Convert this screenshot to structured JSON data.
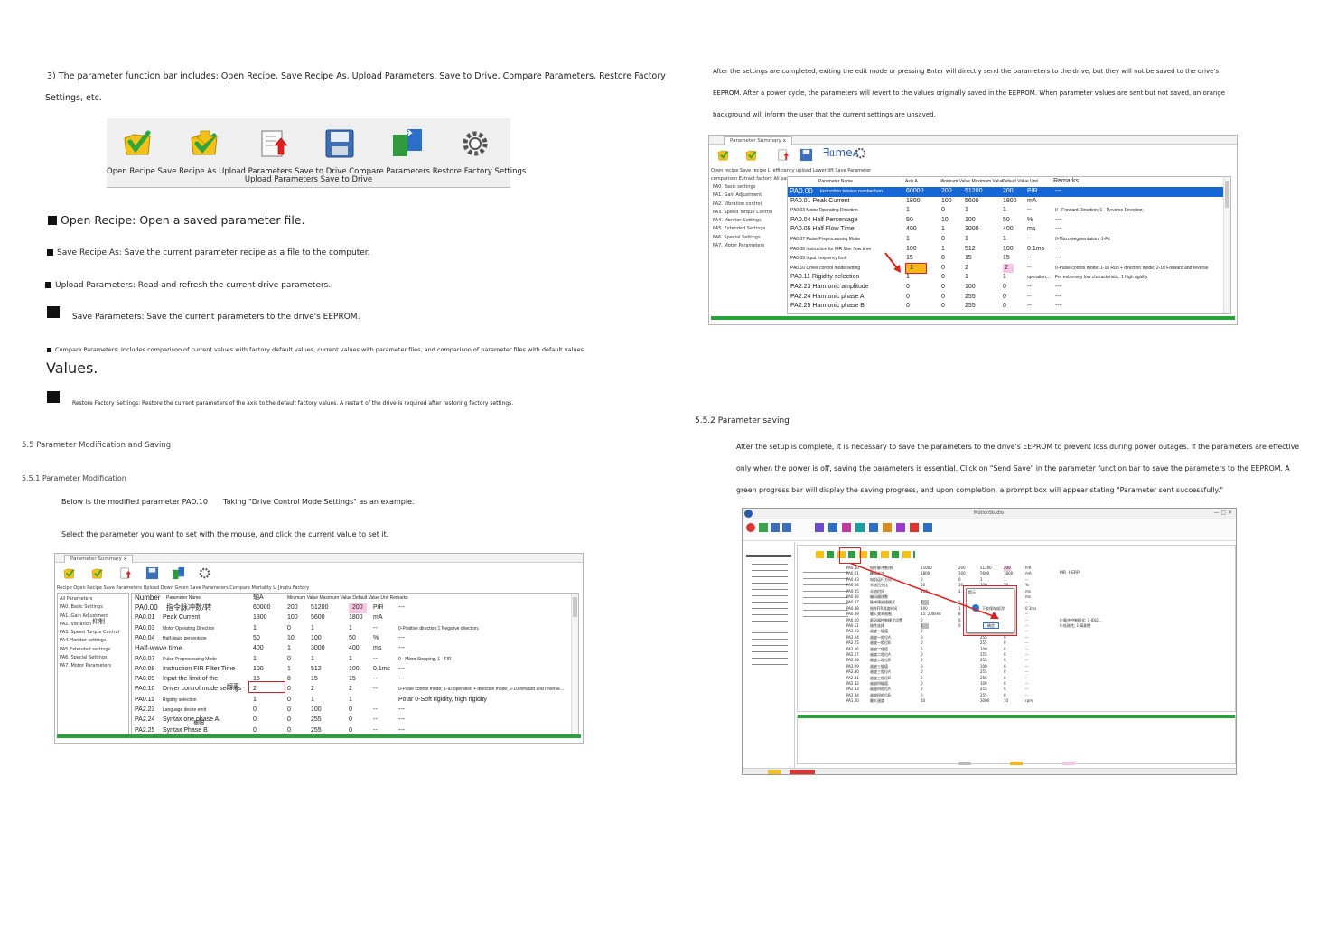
{
  "left": {
    "intro_line1": "3) The parameter function bar includes: Open Recipe, Save Recipe As, Upload Parameters, Save to Drive, Compare Parameters, Restore Factory",
    "intro_line2": "Settings, etc.",
    "toolbar_caption_line1": "Open Recipe Save Recipe As Upload Parameters Save to Drive Compare Parameters Restore Factory Settings",
    "toolbar_caption_line2": "Upload Parameters Save to Drive",
    "bullet_open": "Open Recipe: Open a saved parameter file.",
    "bullet_save_as": "Save Recipe As: Save the current parameter recipe as a file to the computer.",
    "bullet_upload": "Upload Parameters: Read and refresh the current drive parameters.",
    "bullet_save": "Save Parameters: Save the current parameters to the drive's EEPROM.",
    "bullet_compare": "Compare Parameters: Includes comparison of current values with factory default values, current values with parameter files, and comparison of parameter files with default values.",
    "values_heading": "Values.",
    "bullet_restore": "Restore Factory Settings: Restore the current parameters of the axis to the default factory values. A restart of the drive is required after restoring factory settings.",
    "section_55": "5.5 Parameter Modification and Saving",
    "section_551": "5.5.1 Parameter Modification",
    "modified_line_a": "Below is the modified parameter PAO.10",
    "modified_line_b": "Taking \"Drive Control Mode Settings\" as an example.",
    "select_line": "Select the parameter you want to set with the mouse, and click the current value to set it."
  },
  "left_window": {
    "tab": "Parameter Summary x",
    "menu": "Recipe Open Recipe Save Parameters Upload Down Green Save Parameters Compare Mortality Li Jingtu Factory",
    "tree": [
      "All Parameters",
      "PA0. Basic Settings",
      "PA1. Gain Adjustment",
      "PA2. Vibration",
      "PA3. Speed Torque Control",
      "PA4.Monitor settings",
      "PA5.Extended settings",
      "PA6. Special Settings",
      "PA7. Motor Parameters"
    ],
    "tree_overlay": "抑制",
    "header": {
      "number": "Number",
      "name": "Parameter Name",
      "axis": "轴A",
      "rest": "Minimum Value Maximum Value Default Value Unit Remarks"
    },
    "rows": [
      {
        "num": "PA0.00",
        "name": "指令脉冲数/转",
        "a": "60000",
        "min": "200",
        "max": "51200",
        "def": "200",
        "unit": "P/R",
        "rem": "---"
      },
      {
        "num": "PA0.01",
        "name": "Peak Current",
        "a": "1800",
        "min": "100",
        "max": "5600",
        "def": "1800",
        "unit": "mA",
        "rem": ""
      },
      {
        "num": "PA0.03",
        "name": "Motor Operating Direction",
        "a": "1",
        "min": "0",
        "max": "1",
        "def": "1",
        "unit": "--",
        "rem": "0-Positive direction;1 Negative direction;"
      },
      {
        "num": "PA0.04",
        "name": "Half-liquid percentage",
        "a": "50",
        "min": "10",
        "max": "100",
        "def": "50",
        "unit": "%",
        "rem": "---"
      },
      {
        "num": "",
        "name": "Half-wave time",
        "a": "400",
        "min": "1",
        "max": "3000",
        "def": "400",
        "unit": "ms",
        "rem": "---"
      },
      {
        "num": "PA0.07",
        "name": "Pulse Preprocessing Mode",
        "a": "1",
        "min": "0",
        "max": "1",
        "def": "1",
        "unit": "--",
        "rem": "0 - Micro Stepping, 1 - FIR"
      },
      {
        "num": "PA0.08",
        "name": "Instruction FIR Filter Time",
        "a": "100",
        "min": "1",
        "max": "512",
        "def": "100",
        "unit": "0.1ms",
        "rem": "---"
      },
      {
        "num": "PA0.09",
        "name": "Input the limit of the",
        "a": "15",
        "min": "8",
        "max": "15",
        "def": "15",
        "unit": "--",
        "rem": "---"
      },
      {
        "num": "PA0.10",
        "name": "Driver control mode settings",
        "a": "2",
        "min": "0",
        "max": "2",
        "def": "2",
        "unit": "--",
        "rem": "0-Pulse control mode; 1-ID operation + direction mode; 2-10 forward and reverse..."
      },
      {
        "num": "PA0.11",
        "name": "Rigidity selection",
        "a": "1",
        "min": "0",
        "max": "1",
        "def": "1",
        "unit": "",
        "rem": "Polar 0-Soft rigidity, high rigidity"
      },
      {
        "num": "PA2.23",
        "name": "Language desire emit",
        "a": "0",
        "min": "0",
        "max": "100",
        "def": "0",
        "unit": "--",
        "rem": "---"
      },
      {
        "num": "PA2.24",
        "name": "Syntax one phase A",
        "a": "0",
        "min": "0",
        "max": "255",
        "def": "0",
        "unit": "--",
        "rem": "---"
      },
      {
        "num": "PA2.25",
        "name": "Syntax Phase B",
        "a": "0",
        "min": "0",
        "max": "255",
        "def": "0",
        "unit": "--",
        "rem": "---"
      }
    ],
    "overlay_1": "频率",
    "overlay_2": "振幅"
  },
  "right": {
    "para1": "After the settings are completed, exiting the edit mode or pressing Enter will directly send the parameters to the drive, but they will not be saved to the drive's",
    "para2": "EEPROM. After a power cycle, the parameters will revert to the values originally saved in the EEPROM. When parameter values are sent but not saved, an orange",
    "para3": "background will inform the user that the current settings are unsaved.",
    "section_552": "5.5.2 Parameter saving",
    "save1": "After the setup is complete, it is necessary to save the parameters to the drive's EEPROM to prevent loss during power outages. If the parameters are effective",
    "save2": "only when the power is off, saving the parameters is essential. Click on \"Send Save\" in the parameter function bar to save the parameters to the EEPROM. A",
    "save3": "green progress bar will display the saving progress, and upon completion, a prompt box will appear stating \"Parameter sent successfully.\""
  },
  "right_window": {
    "tab": "Parameter Summary x",
    "mirrored": "ᖷᥲmeʌ",
    "menu_line1": "Open recipe Save recipe Li efficiency upload Lower lift Save Parameter",
    "menu_line2": "comparison Extract factory All parameter numbers",
    "tree": [
      "PA0. Basic settings",
      "PA1. Gain Adjustment",
      "PA2. Vibration control",
      "PA3. Speed Torque Control",
      "PA4. Monitor Settings",
      "PA5. Extended Settings",
      "PA6. Special Settings",
      "PA7. Motor Parameters"
    ],
    "header": {
      "name": "Parameter Name",
      "axis": "Axis A",
      "minmax": "Minimum Value Maximum Value",
      "default": "Default Value Unit",
      "remarks": "Remarks"
    },
    "rows": [
      {
        "num": "PA0.00",
        "name": "Instruction tension number/turn",
        "a": "60000",
        "min": "200",
        "max": "51200",
        "def": "200",
        "unit": "P/R",
        "rem": "---"
      },
      {
        "num": "",
        "name": "PA0.01 Peak Current",
        "a": "1800",
        "min": "100",
        "max": "5600",
        "def": "1800",
        "unit": "mA",
        "rem": ""
      },
      {
        "num": "",
        "name": "PA0.03 Motor Operating Direction",
        "a": "1",
        "min": "0",
        "max": "1",
        "def": "1",
        "unit": "--",
        "rem": "0 - Forward Direction; 1 - Reverse Direction;"
      },
      {
        "num": "",
        "name": "PA0.04 Half Percentage",
        "a": "50",
        "min": "10",
        "max": "100",
        "def": "50",
        "unit": "%",
        "rem": "---"
      },
      {
        "num": "",
        "name": "PA0.05 Half Flow Time",
        "a": "400",
        "min": "1",
        "max": "3000",
        "def": "400",
        "unit": "ms",
        "rem": "---"
      },
      {
        "num": "",
        "name": "PA0.07 Pulse Preprocessing Mode",
        "a": "1",
        "min": "0",
        "max": "1",
        "def": "1",
        "unit": "--",
        "rem": "0-Micro segmentation; 1-Fir"
      },
      {
        "num": "",
        "name": "PA0.08 Instruction for FIR filter flow time",
        "a": "100",
        "min": "1",
        "max": "512",
        "def": "100",
        "unit": "0.1ms",
        "rem": "---"
      },
      {
        "num": "",
        "name": "PA0.09 Input frequency limit",
        "a": "15",
        "min": "8",
        "max": "15",
        "def": "15",
        "unit": "--",
        "rem": "---"
      },
      {
        "num": "",
        "name": "PA0.10 Driver control mode setting",
        "a": "1",
        "min": "0",
        "max": "2",
        "def": "2",
        "unit": "--",
        "rem": "0-Pulse control mode; 1-10 Run + direction mode; 2-10 Forward and reverse"
      },
      {
        "num": "",
        "name": "PA0.11 Rigidity selection",
        "a": "1",
        "min": "0",
        "max": "1",
        "def": "1",
        "unit": "operation...",
        "rem": "For extremely low characteristic; 1 high rigidity"
      },
      {
        "num": "",
        "name": "PA2.23 Harmonic amplitude",
        "a": "0",
        "min": "0",
        "max": "100",
        "def": "0",
        "unit": "--",
        "rem": "---"
      },
      {
        "num": "",
        "name": "PA2.24 Harmonic phase A",
        "a": "0",
        "min": "0",
        "max": "255",
        "def": "0",
        "unit": "--",
        "rem": "---"
      },
      {
        "num": "",
        "name": "PA2.25 Harmonic phase B",
        "a": "0",
        "min": "0",
        "max": "255",
        "def": "0",
        "unit": "--",
        "rem": "---"
      }
    ]
  },
  "sw": {
    "title": "MotionStudio",
    "dialog_ok": "确定",
    "dialog_title": "提示",
    "dialog_msg": "下发保存成功!",
    "rows": [
      [
        "PA0.00",
        "指令脉冲数/转",
        "25000",
        "200",
        "51200",
        "200",
        "P/R"
      ],
      [
        "PA0.01",
        "峰值电流",
        "1800",
        "100",
        "5600",
        "1800",
        "mA"
      ],
      [
        "PA0.03",
        "电机运行方向",
        "0",
        "0",
        "1",
        "1",
        "--"
      ],
      [
        "PA0.04",
        "半流百分比",
        "50",
        "10",
        "100",
        "50",
        "%"
      ],
      [
        "PA0.05",
        "半流时间",
        "400",
        "1",
        "3000",
        "400",
        "ms"
      ],
      [
        "PA0.06",
        "编码器线数",
        "",
        "",
        "65535",
        "400",
        "ms"
      ],
      [
        "PA0.07",
        "脉冲预处理模式",
        "1",
        "0",
        "1",
        "1",
        "--"
      ],
      [
        "PA0.08",
        "指令FIR滤波时间",
        "100",
        "1",
        "512",
        "100",
        "0.1ms"
      ],
      [
        "PA0.09",
        "输入频率限制",
        "15: 200kHz",
        "8",
        "15",
        "15",
        "--"
      ],
      [
        "PA0.10",
        "驱动器控制模式设置",
        "0",
        "0",
        "2",
        "2",
        "--"
      ],
      [
        "PA0.11",
        "刚性选择",
        "1",
        "0",
        "1",
        "1",
        "--"
      ],
      [
        "PA2.23",
        "谐波一幅值",
        "0",
        "",
        "100",
        "0",
        "--"
      ],
      [
        "PA2.24",
        "谐波一相位A",
        "0",
        "",
        "255",
        "0",
        "--"
      ],
      [
        "PA2.25",
        "谐波一相位B",
        "0",
        "",
        "255",
        "0",
        "--"
      ],
      [
        "PA2.26",
        "谐波二幅值",
        "0",
        "",
        "100",
        "0",
        "--"
      ],
      [
        "PA2.27",
        "谐波二相位A",
        "0",
        "",
        "255",
        "0",
        "--"
      ],
      [
        "PA2.28",
        "谐波二相位B",
        "0",
        "",
        "255",
        "0",
        "--"
      ],
      [
        "PA2.29",
        "谐波三幅值",
        "0",
        "",
        "100",
        "0",
        "--"
      ],
      [
        "PA2.30",
        "谐波三相位A",
        "0",
        "",
        "255",
        "0",
        "--"
      ],
      [
        "PA2.31",
        "谐波三相位B",
        "0",
        "",
        "255",
        "0",
        "--"
      ],
      [
        "PA2.32",
        "谐波四幅值",
        "0",
        "",
        "100",
        "0",
        "--"
      ],
      [
        "PA2.33",
        "谐波四相位A",
        "0",
        "",
        "255",
        "0",
        "--"
      ],
      [
        "PA2.34",
        "谐波四相位B",
        "0",
        "",
        "255",
        "0",
        "--"
      ],
      [
        "PA1.00",
        "最大速度",
        "10",
        "",
        "3000",
        "10",
        "rpm"
      ]
    ],
    "remark_mr": "MR. HERP",
    "remark2": "0-脉冲控制模式; 1-IO运...",
    "remark3": "0-低刚性; 1-高刚性"
  }
}
